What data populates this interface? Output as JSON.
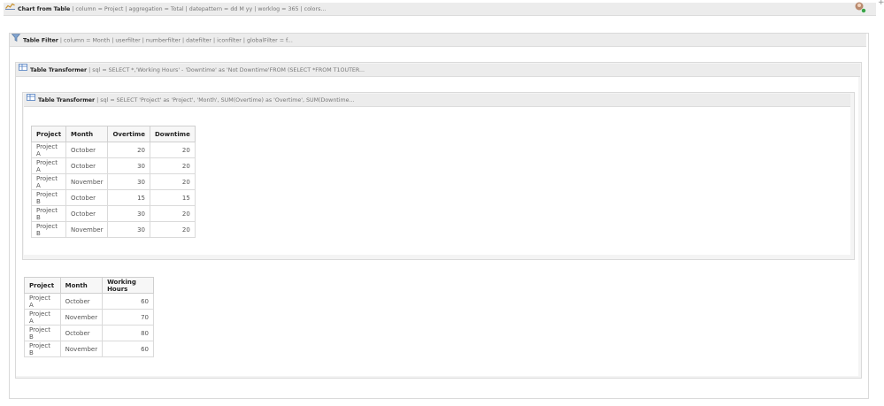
{
  "chart_macro": {
    "title": "Chart from Table",
    "params": " | column = Project | aggregation = Total | datepattern = dd M yy | worklog = 365 | colors..."
  },
  "filter_macro": {
    "title": "Table Filter",
    "params": " | column = Month | userfilter | numberfilter | datefilter | iconfilter | globalFilter = f..."
  },
  "transformer_outer": {
    "title": "Table Transformer",
    "params": " | sql = SELECT *,'Working Hours' - 'Downtime' as 'Not Downtime'FROM (SELECT *FROM T1OUTER..."
  },
  "transformer_inner": {
    "title": "Table Transformer",
    "params": " | sql = SELECT 'Project' as 'Project', 'Month', SUM(Overtime) as 'Overtime', SUM(Downtime..."
  },
  "overtime_table": {
    "headers": [
      "Project",
      "Month",
      "Overtime",
      "Downtime"
    ],
    "rows": [
      [
        "Project A",
        "October",
        "20",
        "20"
      ],
      [
        "Project A",
        "October",
        "30",
        "20"
      ],
      [
        "Project A",
        "November",
        "30",
        "20"
      ],
      [
        "Project B",
        "October",
        "15",
        "15"
      ],
      [
        "Project B",
        "October",
        "30",
        "20"
      ],
      [
        "Project B",
        "November",
        "30",
        "20"
      ]
    ]
  },
  "hours_table": {
    "headers": [
      "Project",
      "Month",
      "Working Hours"
    ],
    "rows": [
      [
        "Project A",
        "October",
        "60"
      ],
      [
        "Project A",
        "November",
        "70"
      ],
      [
        "Project B",
        "October",
        "80"
      ],
      [
        "Project B",
        "November",
        "60"
      ]
    ]
  }
}
